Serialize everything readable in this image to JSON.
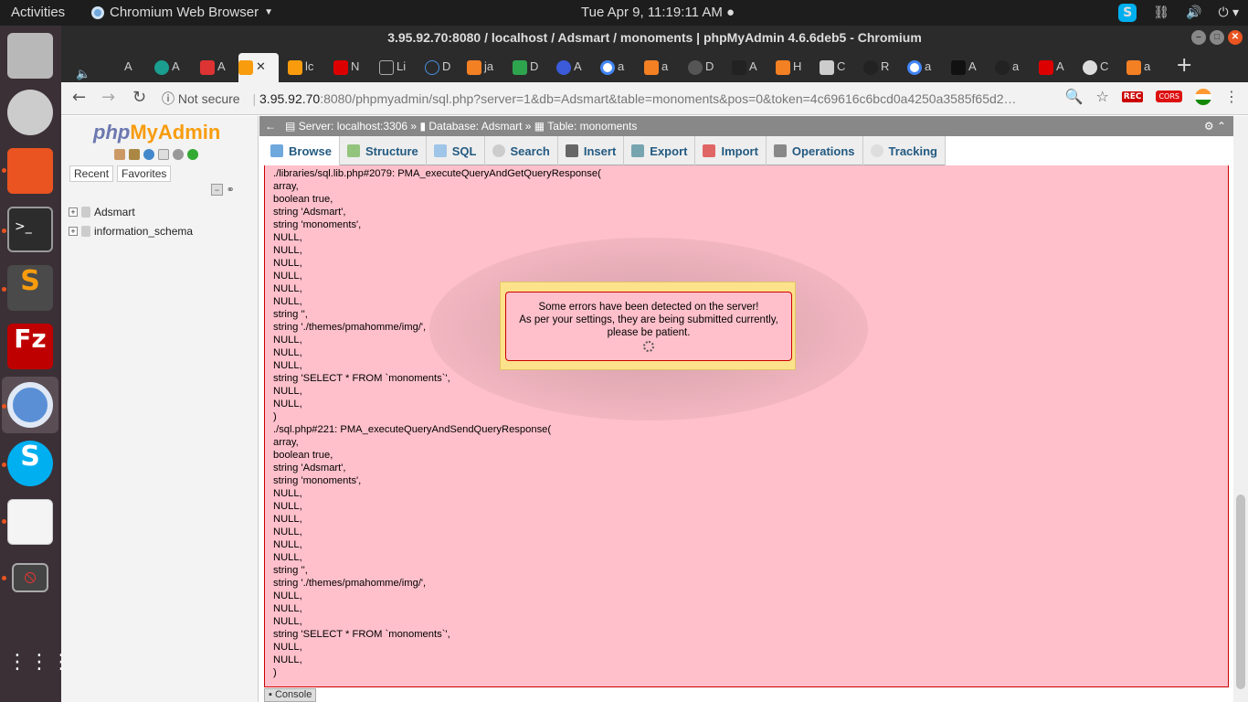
{
  "system": {
    "activities": "Activities",
    "app_menu": "Chromium Web Browser",
    "clock": "Tue Apr  9, 11:19:11 AM"
  },
  "browser": {
    "window_title": "3.95.92.70:8080 / localhost / Adsmart / monoments | phpMyAdmin 4.6.6deb5 - Chromium",
    "tabs": [
      "A",
      "A",
      "A",
      "A",
      "",
      "lc",
      "N",
      "Li",
      "D",
      "ja",
      "D",
      "A",
      "a",
      "a",
      "D",
      "A",
      "H",
      "C",
      "R",
      "a",
      "A",
      "a",
      "A",
      "C",
      "a"
    ],
    "address": {
      "security": "Not secure",
      "host": "3.95.92.70",
      "rest": ":8080/phpmyadmin/sql.php?server=1&db=Adsmart&table=monoments&pos=0&token=4c69616c6bcd0a4250a3585f65d2…"
    },
    "ext_rec": "REC",
    "ext_cors": "CORS"
  },
  "pma": {
    "logo_php": "php",
    "logo_myadmin": "MyAdmin",
    "nav_tabs": [
      "Recent",
      "Favorites"
    ],
    "databases": [
      "Adsmart",
      "information_schema"
    ],
    "breadcrumb": {
      "server": "Server: localhost:3306",
      "database": "Database: Adsmart",
      "table": "Table: monoments"
    },
    "tabs": [
      "Browse",
      "Structure",
      "SQL",
      "Search",
      "Insert",
      "Export",
      "Import",
      "Operations",
      "Tracking"
    ],
    "error_lines": [
      "./libraries/sql.lib.php#2079: PMA_executeQueryAndGetQueryResponse(",
      "array,",
      "boolean true,",
      "string 'Adsmart',",
      "string 'monoments',",
      "NULL,",
      "NULL,",
      "NULL,",
      "NULL,",
      "NULL,",
      "NULL,",
      "string '',",
      "string './themes/pmahomme/img/',",
      "NULL,",
      "NULL,",
      "NULL,",
      "string 'SELECT * FROM `monoments`',",
      "NULL,",
      "NULL,",
      ")",
      "./sql.php#221: PMA_executeQueryAndSendQueryResponse(",
      "array,",
      "boolean true,",
      "string 'Adsmart',",
      "string 'monoments',",
      "NULL,",
      "NULL,",
      "NULL,",
      "NULL,",
      "NULL,",
      "NULL,",
      "string '',",
      "string './themes/pmahomme/img/',",
      "NULL,",
      "NULL,",
      "NULL,",
      "string 'SELECT * FROM `monoments`',",
      "NULL,",
      "NULL,",
      ")"
    ],
    "console": "Console",
    "dialog": {
      "line1": "Some errors have been detected on the server!",
      "line2": "As per your settings, they are being submitted currently,",
      "line3": "please be patient."
    }
  }
}
